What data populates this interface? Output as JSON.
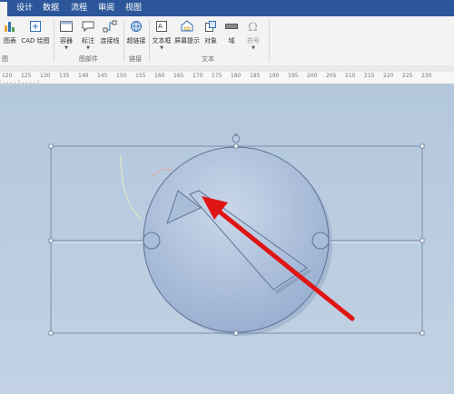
{
  "tabs": [
    "设计",
    "数据",
    "流程",
    "审阅",
    "视图"
  ],
  "ribbon": {
    "buttons": {
      "chart": "图表",
      "cad": "CAD 绘图",
      "container": "容器",
      "callout": "标注",
      "connector": "连接线",
      "hyperlink": "超链接",
      "textbox": "文本框",
      "screentip": "屏幕提示",
      "object": "对象",
      "field": "域",
      "symbol": "符号"
    },
    "groups": {
      "illustrations": "图",
      "diagram_parts": "图部件",
      "links": "链接",
      "text": "文本"
    }
  },
  "ruler": {
    "ticks": [
      "120",
      "125",
      "130",
      "135",
      "140",
      "145",
      "150",
      "155",
      "160",
      "165",
      "170",
      "175",
      "180",
      "185",
      "190",
      "195",
      "200",
      "205",
      "210",
      "215",
      "220",
      "225",
      "230"
    ]
  },
  "colors": {
    "tabbar": "#2b579a",
    "canvas": "#b7c9de",
    "arrow": "#e01515",
    "shape_fill": "#a8bdd8",
    "selection": "#6b7f99"
  },
  "icons": [
    "chart-icon",
    "cad-icon",
    "container-icon",
    "callout-icon",
    "connector-icon",
    "hyperlink-icon",
    "textbox-icon",
    "screentip-icon",
    "object-icon",
    "field-icon",
    "symbol-icon",
    "rotate-handle-icon"
  ]
}
